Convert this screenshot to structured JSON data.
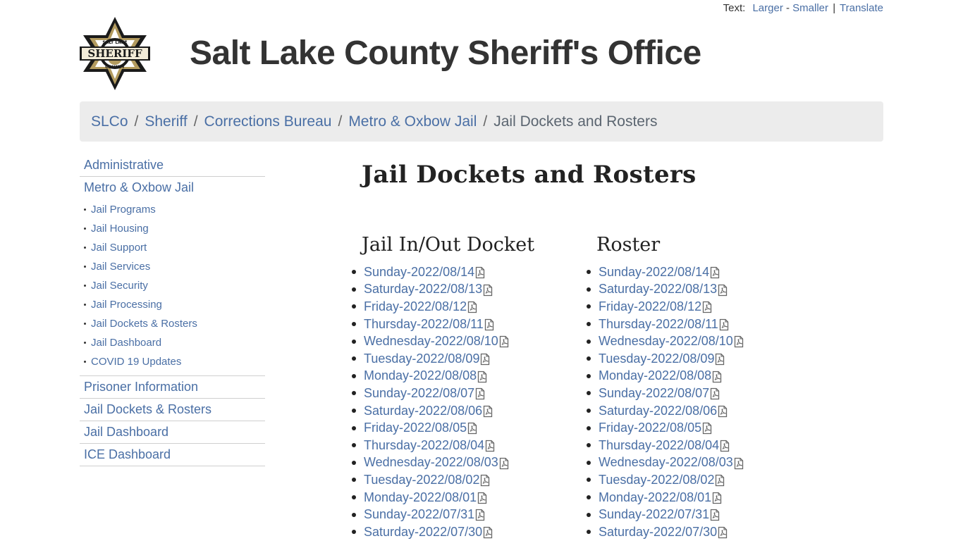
{
  "top_links": {
    "text_label": "Text:",
    "larger": "Larger",
    "dash": "-",
    "smaller": "Smaller",
    "pipe": "|",
    "translate": "Translate"
  },
  "header": {
    "logo_alt": "Salt Lake County Sheriff badge",
    "logo_text_top": "SALT LAKE",
    "logo_text_main": "SHERIFF",
    "logo_text_bottom": "COUNTY",
    "title": "Salt Lake County Sheriff's Office"
  },
  "breadcrumb": {
    "items": [
      "SLCo",
      "Sheriff",
      "Corrections Bureau",
      "Metro & Oxbow Jail"
    ],
    "current": "Jail Dockets and Rosters",
    "divider": "/"
  },
  "sidebar": {
    "top_items": [
      "Administrative",
      "Metro & Oxbow Jail"
    ],
    "sub_items": [
      "Jail Programs",
      "Jail Housing",
      "Jail Support",
      "Jail Services",
      "Jail Security",
      "Jail Processing",
      "Jail Dockets & Rosters",
      "Jail Dashboard",
      "COVID 19 Updates"
    ],
    "bottom_items": [
      "Prisoner Information",
      "Jail Dockets & Rosters",
      "Jail Dashboard",
      "ICE Dashboard"
    ]
  },
  "main": {
    "heading": "Jail Dockets and Rosters",
    "docket": {
      "title": "Jail In/Out Docket",
      "items": [
        "Sunday-2022/08/14",
        "Saturday-2022/08/13",
        "Friday-2022/08/12",
        "Thursday-2022/08/11",
        "Wednesday-2022/08/10",
        "Tuesday-2022/08/09",
        "Monday-2022/08/08",
        "Sunday-2022/08/07",
        "Saturday-2022/08/06",
        "Friday-2022/08/05",
        "Thursday-2022/08/04",
        "Wednesday-2022/08/03",
        "Tuesday-2022/08/02",
        "Monday-2022/08/01",
        "Sunday-2022/07/31",
        "Saturday-2022/07/30"
      ]
    },
    "roster": {
      "title": "Roster",
      "items": [
        "Sunday-2022/08/14",
        "Saturday-2022/08/13",
        "Friday-2022/08/12",
        "Thursday-2022/08/11",
        "Wednesday-2022/08/10",
        "Tuesday-2022/08/09",
        "Monday-2022/08/08",
        "Sunday-2022/08/07",
        "Saturday-2022/08/06",
        "Friday-2022/08/05",
        "Thursday-2022/08/04",
        "Wednesday-2022/08/03",
        "Tuesday-2022/08/02",
        "Monday-2022/08/01",
        "Sunday-2022/07/31",
        "Saturday-2022/07/30"
      ]
    },
    "file_icon": "pdf-icon"
  },
  "colors": {
    "link": "#4a6fa5",
    "text": "#333333",
    "breadcrumb_bg": "#ececec",
    "badge_gold": "#b39b5f",
    "badge_black": "#1a1a1a"
  }
}
